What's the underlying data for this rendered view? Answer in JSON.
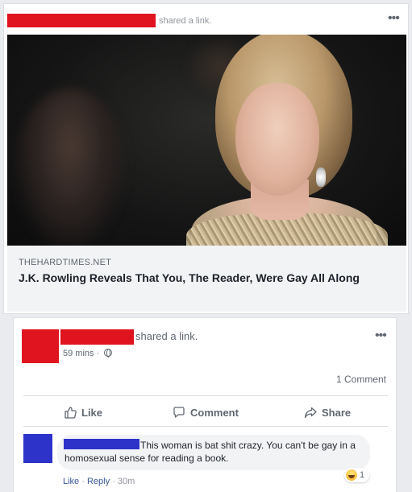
{
  "outer_post": {
    "shared_prefix": "shared a ",
    "shared_link": "link",
    "shared_suffix": "."
  },
  "link_preview": {
    "domain": "THEHARDTIMES.NET",
    "title": "J.K. Rowling Reveals That You, The Reader, Were Gay All Along"
  },
  "inner_post": {
    "shared_text": "shared a link.",
    "timestamp": "59 mins",
    "timestamp_separator": "·",
    "comment_count": "1 Comment",
    "actions": {
      "like": "Like",
      "comment": "Comment",
      "share": "Share"
    }
  },
  "comment": {
    "text": "This woman is bat shit crazy. You can't be gay in a homosexual sense for reading a book.",
    "reaction_count": "1",
    "like": "Like",
    "reply": "Reply",
    "age": "30m",
    "separator": "·"
  },
  "colors": {
    "redaction_red": "#e0141e",
    "redaction_blue": "#2d32c9",
    "fb_link_blue": "#385898"
  }
}
